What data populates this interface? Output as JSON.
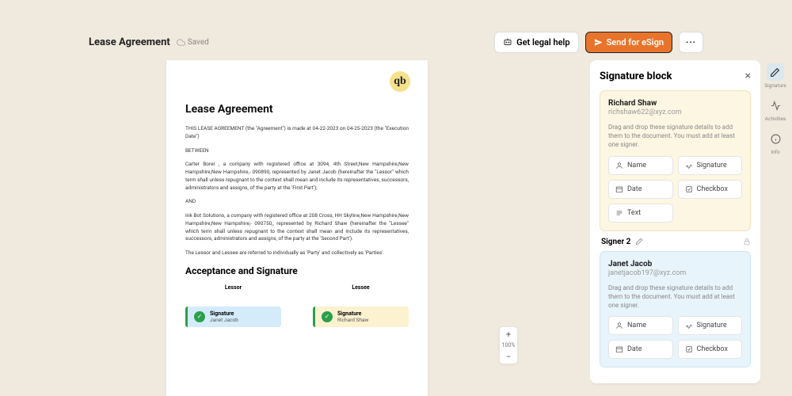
{
  "topbar": {
    "title": "Lease Agreement",
    "saved": "Saved",
    "legal_help": "Get legal help",
    "send": "Send for eSign"
  },
  "doc": {
    "logo": "qb",
    "h1": "Lease Agreement",
    "p1": "THIS LEASE AGREEMENT (the \"Agreement\") is made at 04-22-2023 on 04-25-2023 (the \"Execution Date\")",
    "p2": "BETWEEN",
    "p3": "Carter Borer , a company with registered office at 3094, 4th Street,New Hampshire,New Hampshire,New Hampshire,- 090890, represented by Janet Jacob (hereinafter the \"Lessor\" which term shall unless repugnant to the context shall mean and include its representatives, successors, administrators and assigns, of the party at the 'First Part');",
    "p4": "AND",
    "p5": "Ink Bot Solutions, a company with registered office at 208 Cross, HH Skyline,New Hampshire,New Hampshire,New Hampshire,- 090750,, represented by Richard Shaw (hereinafter the \"Lessee\" which term shall unless repugnant to the context shall mean and include its representatives, successors, administrators and assigns, of the party at the 'Second Part').",
    "p6": "The Lessor and Lessee are referred to individually as 'Party' and collectively as 'Parties'.",
    "h2": "Acceptance and Signature",
    "lessor": "Lessor",
    "lessee": "Lessee",
    "sig_label": "Signature",
    "sig1_name": "Janet Jacob",
    "sig2_name": "Richard Shaw"
  },
  "zoom": {
    "pct": "100%"
  },
  "panel": {
    "title": "Signature block",
    "hint": "Drag and drop these signature details to add them to the document. You must add at least one signer.",
    "fields": {
      "name": "Name",
      "signature": "Signature",
      "date": "Date",
      "checkbox": "Checkbox",
      "text": "Text"
    },
    "signer2": "Signer 2",
    "s1": {
      "name": "Richard Shaw",
      "email": "richshaw622@xyz.com"
    },
    "s2": {
      "name": "Janet Jacob",
      "email": "janetjacob197@xyz.com"
    }
  },
  "rail": {
    "signature": "Signature",
    "activities": "Activities",
    "info": "Info"
  }
}
